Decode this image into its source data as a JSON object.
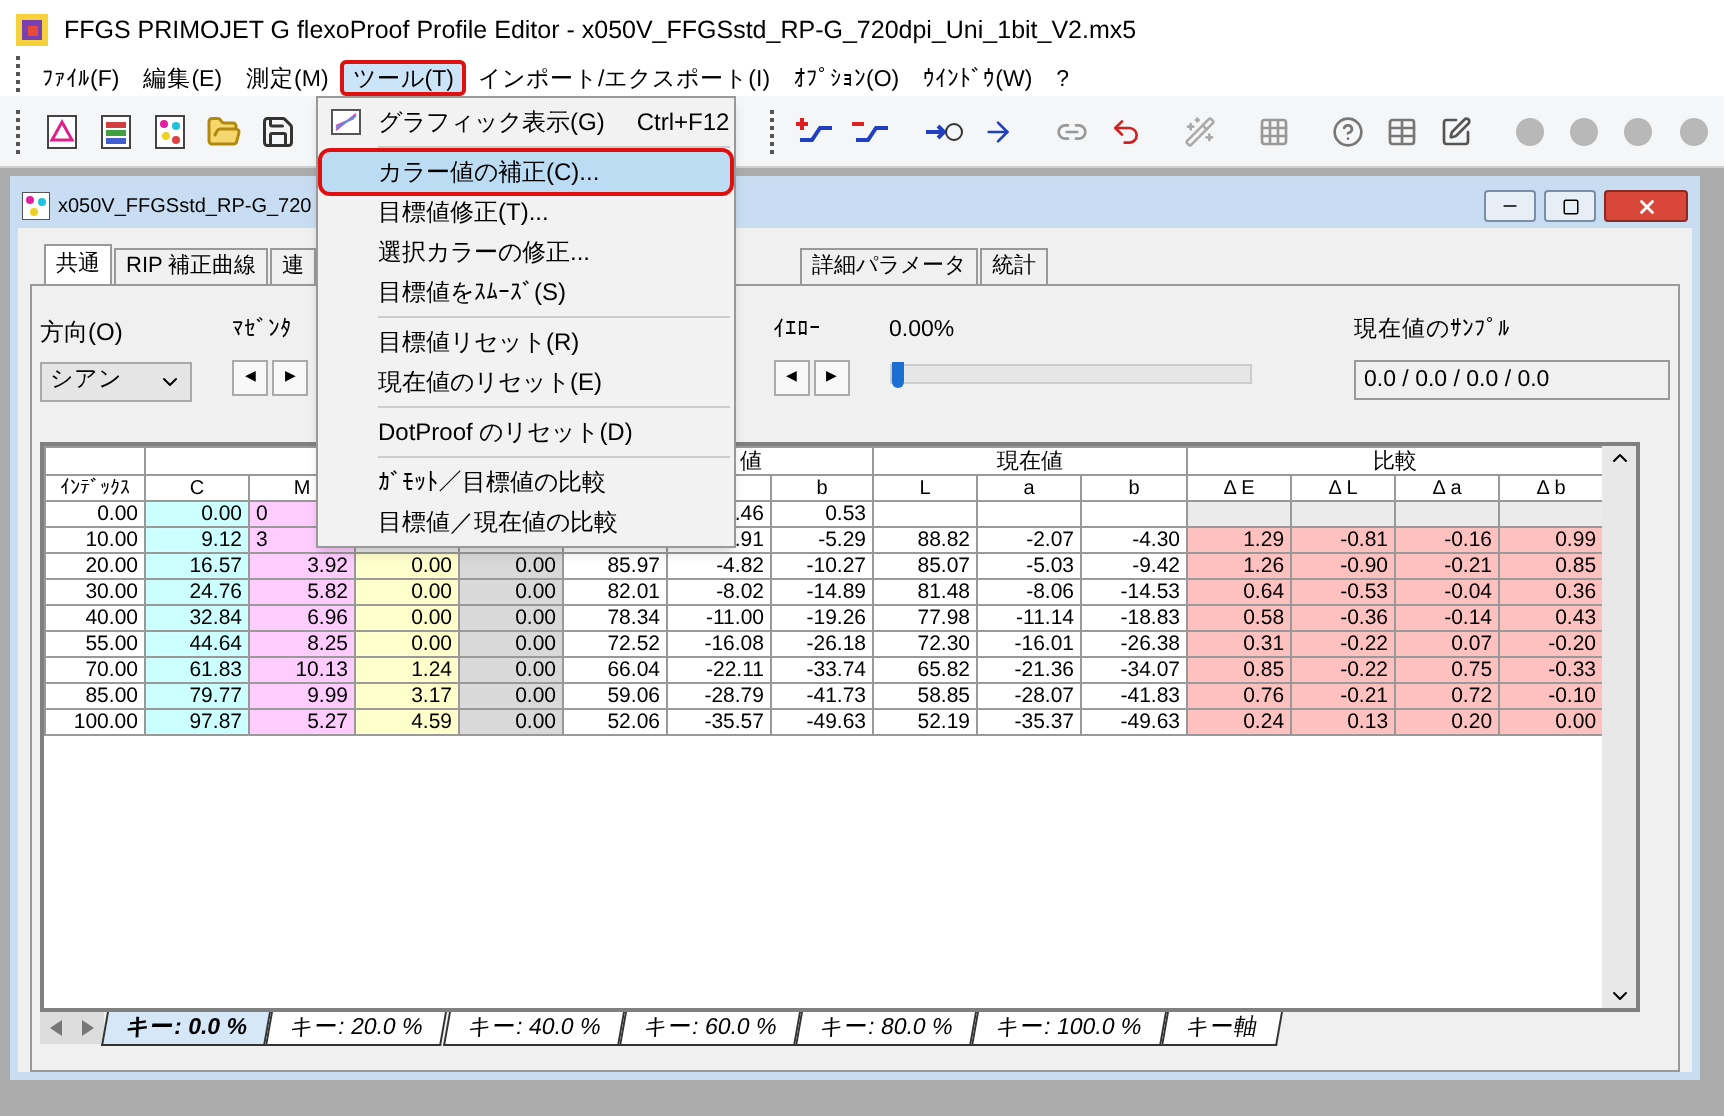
{
  "window": {
    "title": "FFGS PRIMOJET G flexoProof Profile Editor - x050V_FFGSstd_RP-G_720dpi_Uni_1bit_V2.mx5"
  },
  "menubar": [
    {
      "label": "ﾌｧｲﾙ(F)",
      "selected": false,
      "outlined": false
    },
    {
      "label": "編集(E)",
      "selected": false,
      "outlined": false
    },
    {
      "label": "測定(M)",
      "selected": false,
      "outlined": false
    },
    {
      "label": "ツール(T)",
      "selected": true,
      "outlined": true
    },
    {
      "label": "インポート/エクスポート(I)",
      "selected": false,
      "outlined": false
    },
    {
      "label": "ｵﾌﾟｼｮﾝ(O)",
      "selected": false,
      "outlined": false
    },
    {
      "label": "ｳｲﾝﾄﾞｳ(W)",
      "selected": false,
      "outlined": false
    },
    {
      "label": "?",
      "selected": false,
      "outlined": false
    }
  ],
  "menu": [
    {
      "kind": "item",
      "label": "グラフィック表示(G)",
      "shortcut": "Ctrl+F12",
      "icon": true,
      "selected": false,
      "outlined": false
    },
    {
      "kind": "separator"
    },
    {
      "kind": "item",
      "label": "カラー値の補正(C)...",
      "selected": true,
      "outlined": true
    },
    {
      "kind": "item",
      "label": "目標値修正(T)...",
      "selected": false,
      "outlined": false
    },
    {
      "kind": "item",
      "label": "選択カラーの修正...",
      "selected": false,
      "outlined": false
    },
    {
      "kind": "item",
      "label": "目標値をｽﾑｰｽﾞ(S)",
      "selected": false,
      "outlined": false
    },
    {
      "kind": "separator"
    },
    {
      "kind": "item",
      "label": "目標値リセット(R)",
      "selected": false,
      "outlined": false
    },
    {
      "kind": "item",
      "label": "現在値のリセット(E)",
      "selected": false,
      "outlined": false
    },
    {
      "kind": "separator"
    },
    {
      "kind": "item",
      "label": "DotProof のリセット(D)",
      "selected": false,
      "outlined": false
    },
    {
      "kind": "separator"
    },
    {
      "kind": "item",
      "label": "ｶﾞﾓｯﾄ／目標値の比較",
      "selected": false,
      "outlined": false
    },
    {
      "kind": "item",
      "label": "目標値／現在値の比較",
      "selected": false,
      "outlined": false
    }
  ],
  "document": {
    "title": "x050V_FFGSstd_RP-G_720",
    "tabs": [
      {
        "label": "共通",
        "selected": true
      },
      {
        "label": "RIP 補正曲線",
        "selected": false
      },
      {
        "label": "連",
        "selected": false
      },
      {
        "label": "詳細パラメータ",
        "selected": false
      },
      {
        "label": "統計",
        "selected": false
      }
    ],
    "direction": {
      "label": "方向(O)",
      "value": "シアン"
    },
    "magenta": {
      "label": "ﾏｾﾞﾝﾀ",
      "prev": "◀",
      "next": "▶"
    },
    "yellow": {
      "label": "ｲｴﾛｰ",
      "prev": "◀",
      "next": "▶",
      "reading": "0.00%",
      "level": 0
    },
    "sample": {
      "label": "現在値のｻﾝﾌﾟﾙ",
      "value": "0.0 / 0.0 / 0.0 / 0.0"
    },
    "table": {
      "groups": [
        {
          "columns": [
            {
              "label": "ｲﾝﾃﾞｯｸｽ"
            }
          ]
        },
        {
          "columns": [
            {
              "label": "C",
              "color": "#ccffff"
            },
            {
              "label": "M",
              "color": "#ffccff"
            },
            {
              "color": "#ffffcc"
            },
            {
              "color": "#d9d9d9"
            }
          ]
        },
        {
          "label": "値",
          "cut": true,
          "columns": [
            {},
            {},
            {
              "label": "b"
            }
          ]
        },
        {
          "label": "現在値",
          "columns": [
            {
              "label": "L"
            },
            {
              "label": "a"
            },
            {
              "label": "b"
            }
          ]
        },
        {
          "label": "比較",
          "columns": [
            {
              "label": "Δ E",
              "color": "#ffc0c0"
            },
            {
              "label": "Δ L",
              "color": "#ffc0c0"
            },
            {
              "label": "Δ a",
              "color": "#ffc0c0"
            },
            {
              "label": "Δ b",
              "color": "#ffc0c0"
            }
          ]
        }
      ],
      "rows": [
        [
          "0.00",
          "0.00",
          {
            "text": "0",
            "cut": true
          },
          null,
          null,
          null,
          ".46",
          "0.53",
          null,
          null,
          null,
          null,
          null,
          null,
          null
        ],
        [
          "10.00",
          "9.12",
          {
            "text": "3",
            "cut": true
          },
          null,
          null,
          null,
          ".91",
          "-5.29",
          "88.82",
          "-2.07",
          "-4.30",
          "1.29",
          "-0.81",
          "-0.16",
          "0.99"
        ],
        [
          "20.00",
          "16.57",
          "3.92",
          "0.00",
          "0.00",
          "85.97",
          "-4.82",
          "-10.27",
          "85.07",
          "-5.03",
          "-9.42",
          "1.26",
          "-0.90",
          "-0.21",
          "0.85"
        ],
        [
          "30.00",
          "24.76",
          "5.82",
          "0.00",
          "0.00",
          "82.01",
          "-8.02",
          "-14.89",
          "81.48",
          "-8.06",
          "-14.53",
          "0.64",
          "-0.53",
          "-0.04",
          "0.36"
        ],
        [
          "40.00",
          "32.84",
          "6.96",
          "0.00",
          "0.00",
          "78.34",
          "-11.00",
          "-19.26",
          "77.98",
          "-11.14",
          "-18.83",
          "0.58",
          "-0.36",
          "-0.14",
          "0.43"
        ],
        [
          "55.00",
          "44.64",
          "8.25",
          "0.00",
          "0.00",
          "72.52",
          "-16.08",
          "-26.18",
          "72.30",
          "-16.01",
          "-26.38",
          "0.31",
          "-0.22",
          "0.07",
          "-0.20"
        ],
        [
          "70.00",
          "61.83",
          "10.13",
          "1.24",
          "0.00",
          "66.04",
          "-22.11",
          "-33.74",
          "65.82",
          "-21.36",
          "-34.07",
          "0.85",
          "-0.22",
          "0.75",
          "-0.33"
        ],
        [
          "85.00",
          "79.77",
          "9.99",
          "3.17",
          "0.00",
          "59.06",
          "-28.79",
          "-41.73",
          "58.85",
          "-28.07",
          "-41.83",
          "0.76",
          "-0.21",
          "0.72",
          "-0.10"
        ],
        [
          "100.00",
          "97.87",
          "5.27",
          "4.59",
          "0.00",
          "52.06",
          "-35.57",
          "-49.63",
          "52.19",
          "-35.37",
          "-49.63",
          "0.24",
          "0.13",
          "0.20",
          "0.00"
        ]
      ]
    },
    "sheet_tabs": [
      {
        "label": "キー: 0.0 %",
        "selected": true
      },
      {
        "label": "キー: 20.0 %",
        "selected": false
      },
      {
        "label": "キー: 40.0 %",
        "selected": false
      },
      {
        "label": "キー: 60.0 %",
        "selected": false
      },
      {
        "label": "キー: 80.0 %",
        "selected": false
      },
      {
        "label": "キー: 100.0 %",
        "selected": false
      },
      {
        "label": "キー軸",
        "selected": false
      }
    ]
  }
}
